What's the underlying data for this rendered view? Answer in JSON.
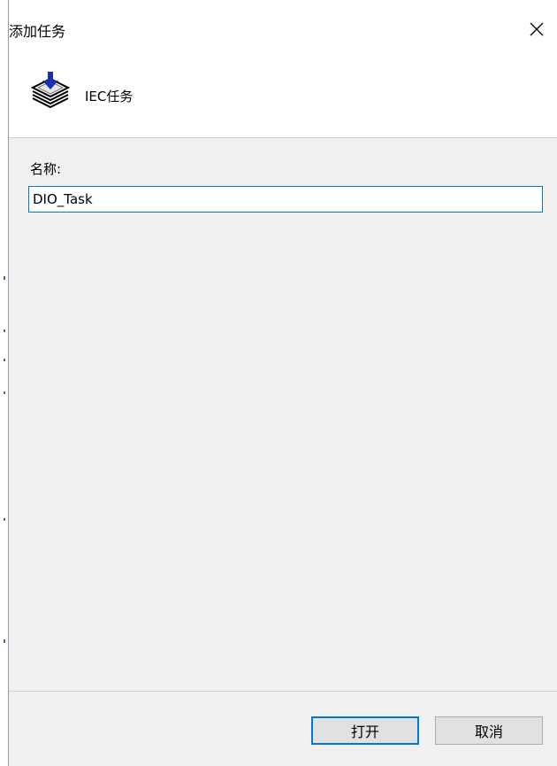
{
  "window": {
    "title": "添加任务",
    "close_label": "close"
  },
  "header": {
    "icon": "task-stack-download-icon",
    "text": "IEC任务"
  },
  "form": {
    "name_label": "名称:",
    "name_value": "DIO_Task"
  },
  "footer": {
    "open_label": "打开",
    "cancel_label": "取消"
  },
  "colors": {
    "accent": "#0078d7",
    "panel": "#f0f0f0",
    "button": "#e1e1e1"
  }
}
